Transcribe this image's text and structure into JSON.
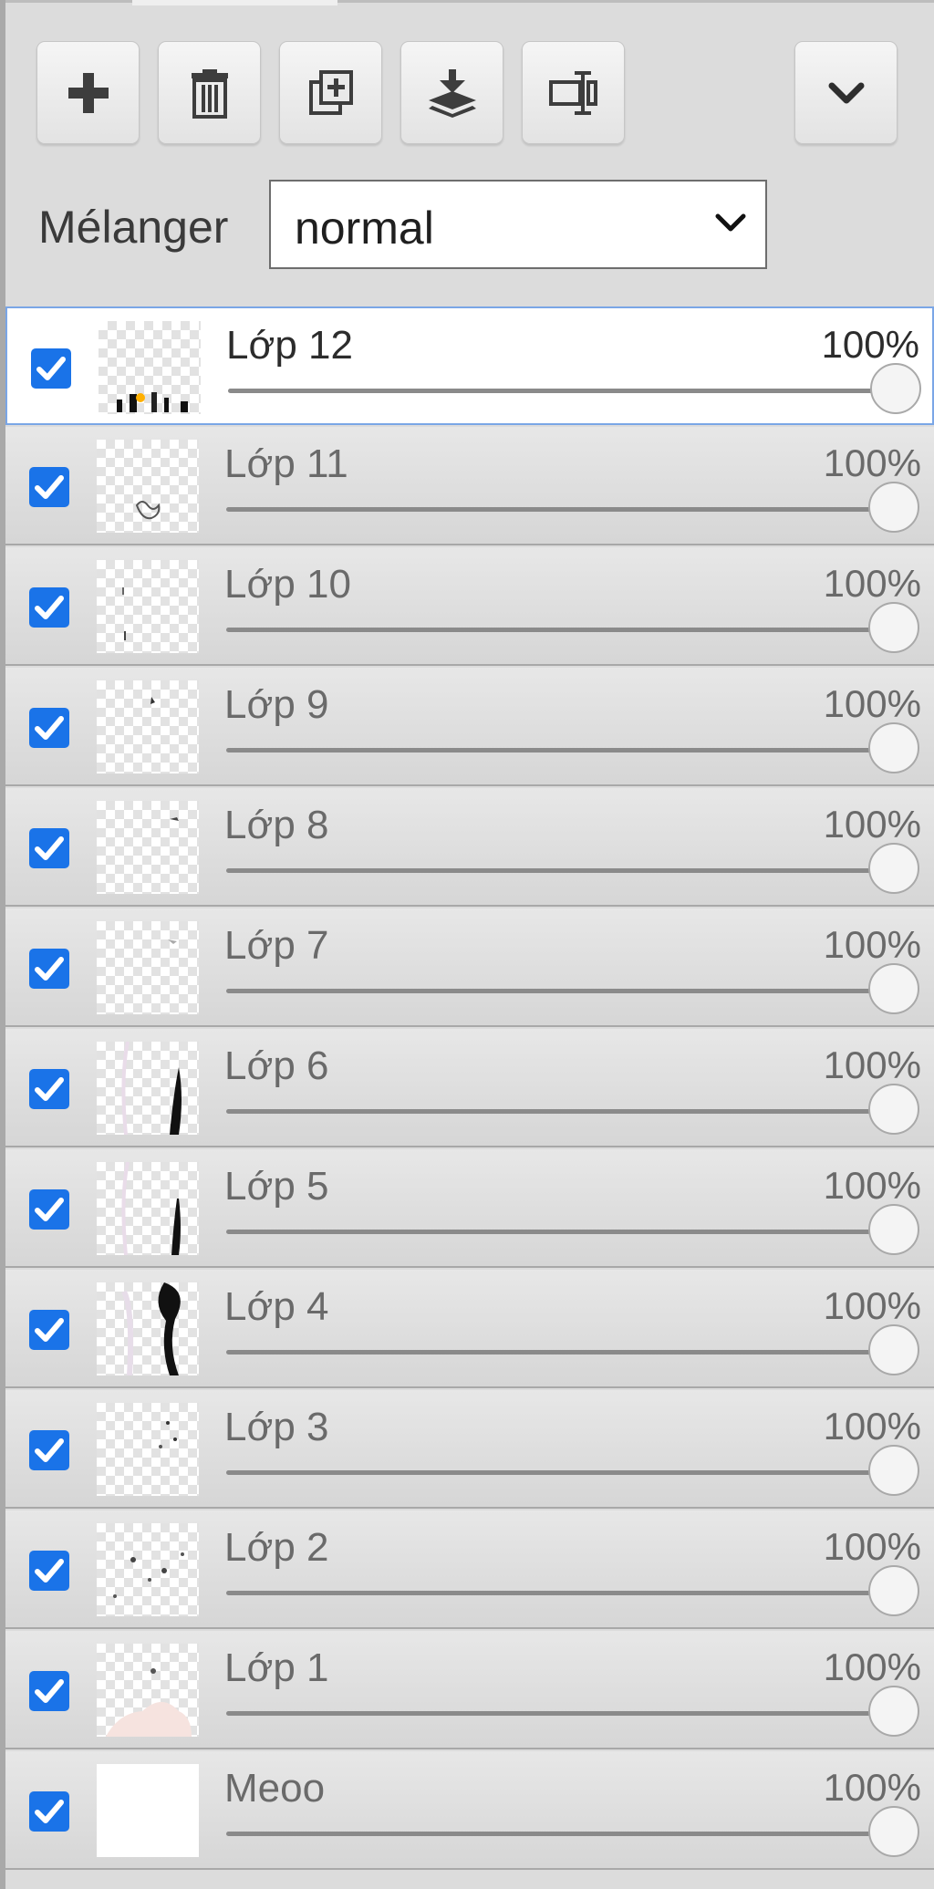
{
  "toolbar": {
    "buttons": [
      {
        "icon": "plus-icon",
        "name": "add-layer-button"
      },
      {
        "icon": "trash-icon",
        "name": "delete-layer-button"
      },
      {
        "icon": "duplicate-icon",
        "name": "duplicate-layer-button"
      },
      {
        "icon": "merge-down-icon",
        "name": "merge-down-button"
      },
      {
        "icon": "rename-icon",
        "name": "rename-layer-button"
      },
      {
        "icon": "chevron-down-icon",
        "name": "more-options-button"
      }
    ]
  },
  "blend": {
    "label": "Mélanger",
    "value": "normal"
  },
  "colors": {
    "checkbox": "#1a73e8",
    "active_border": "#7aa6e6"
  },
  "layers": [
    {
      "name": "Lớp 12",
      "opacity": "100%",
      "visible": true,
      "active": true
    },
    {
      "name": "Lớp 11",
      "opacity": "100%",
      "visible": true,
      "active": false
    },
    {
      "name": "Lớp 10",
      "opacity": "100%",
      "visible": true,
      "active": false
    },
    {
      "name": "Lớp 9",
      "opacity": "100%",
      "visible": true,
      "active": false
    },
    {
      "name": "Lớp 8",
      "opacity": "100%",
      "visible": true,
      "active": false
    },
    {
      "name": "Lớp 7",
      "opacity": "100%",
      "visible": true,
      "active": false
    },
    {
      "name": "Lớp 6",
      "opacity": "100%",
      "visible": true,
      "active": false
    },
    {
      "name": "Lớp 5",
      "opacity": "100%",
      "visible": true,
      "active": false
    },
    {
      "name": "Lớp 4",
      "opacity": "100%",
      "visible": true,
      "active": false
    },
    {
      "name": "Lớp 3",
      "opacity": "100%",
      "visible": true,
      "active": false
    },
    {
      "name": "Lớp 2",
      "opacity": "100%",
      "visible": true,
      "active": false
    },
    {
      "name": "Lớp 1",
      "opacity": "100%",
      "visible": true,
      "active": false
    },
    {
      "name": "Meoo",
      "opacity": "100%",
      "visible": true,
      "active": false
    }
  ]
}
